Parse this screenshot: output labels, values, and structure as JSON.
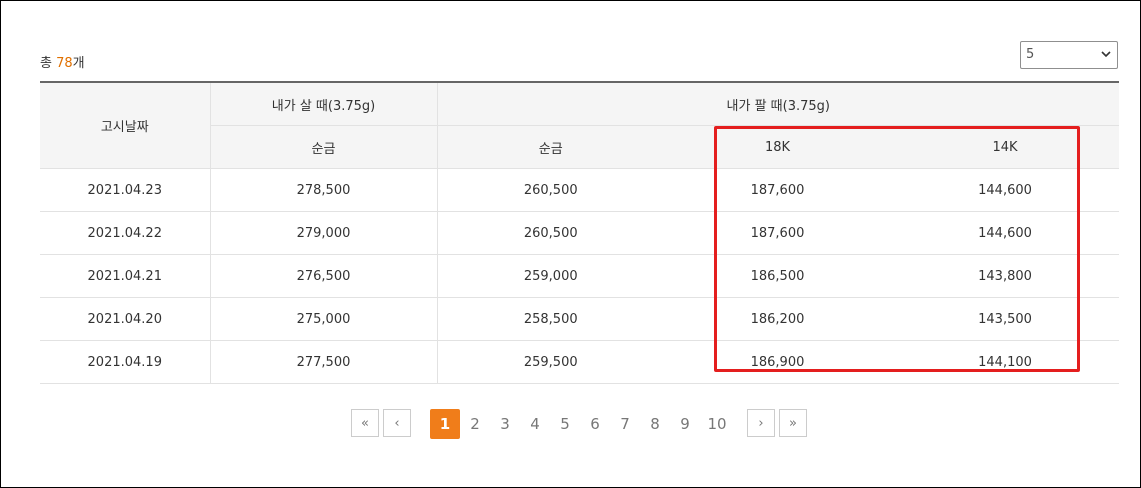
{
  "summary": {
    "prefix": "총 ",
    "count": "78",
    "suffix": "개"
  },
  "page_size_select": {
    "value": "5"
  },
  "table": {
    "headers": {
      "date": "고시날짜",
      "buy_group": "내가 살 때(3.75g)",
      "sell_group": "내가 팔 때(3.75g)",
      "buy_pure": "순금",
      "sell_pure": "순금",
      "sell_18k": "18K",
      "sell_14k": "14K"
    },
    "rows": [
      {
        "date": "2021.04.23",
        "buy_pure": "278,500",
        "sell_pure": "260,500",
        "sell_18k": "187,600",
        "sell_14k": "144,600"
      },
      {
        "date": "2021.04.22",
        "buy_pure": "279,000",
        "sell_pure": "260,500",
        "sell_18k": "187,600",
        "sell_14k": "144,600"
      },
      {
        "date": "2021.04.21",
        "buy_pure": "276,500",
        "sell_pure": "259,000",
        "sell_18k": "186,500",
        "sell_14k": "143,800"
      },
      {
        "date": "2021.04.20",
        "buy_pure": "275,000",
        "sell_pure": "258,500",
        "sell_18k": "186,200",
        "sell_14k": "143,500"
      },
      {
        "date": "2021.04.19",
        "buy_pure": "277,500",
        "sell_pure": "259,500",
        "sell_18k": "186,900",
        "sell_14k": "144,100"
      }
    ]
  },
  "pagination": {
    "first": "«",
    "prev": "‹",
    "pages": [
      "1",
      "2",
      "3",
      "4",
      "5",
      "6",
      "7",
      "8",
      "9",
      "10"
    ],
    "current": "1",
    "next": "›",
    "last": "»"
  },
  "colors": {
    "accent": "#f07d1a",
    "highlight": "#e41e1e"
  }
}
